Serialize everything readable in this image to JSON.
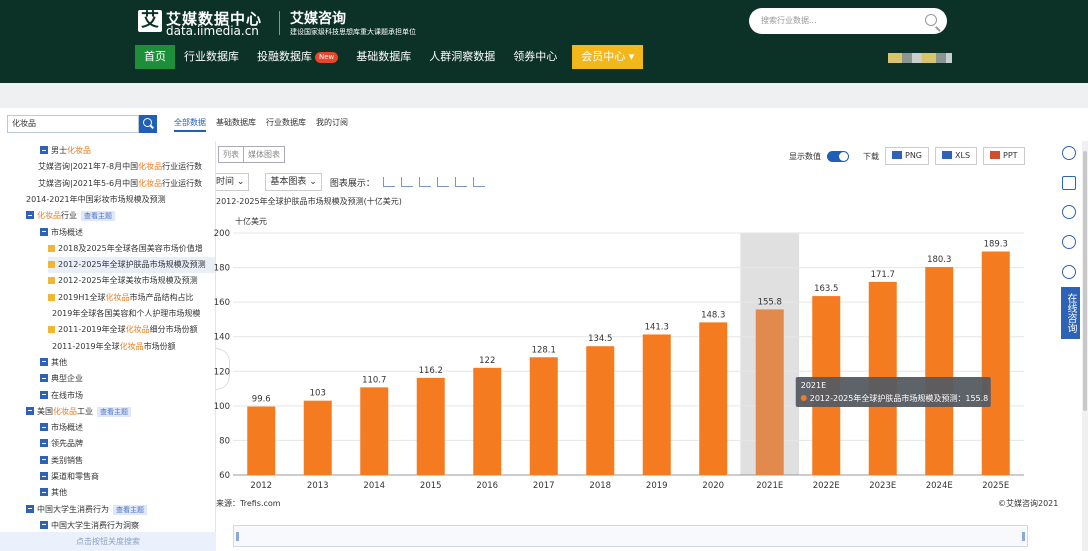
{
  "header": {
    "logo_glyph": "艾",
    "logo_cn": "艾媒数据中心",
    "logo_en": "data.iimedia.cn",
    "brand": "艾媒咨询",
    "brand_sub": "建设国家级科技思想库重大课题承担单位",
    "search_placeholder": "搜索行业数据..."
  },
  "nav": {
    "items": [
      "首页",
      "行业数据库",
      "投融数据库",
      "基础数据库",
      "人群洞察数据",
      "领券中心"
    ],
    "new_badge": "New",
    "member": "会员中心"
  },
  "search": {
    "value": "化妆品"
  },
  "tabs": [
    "全部数据",
    "基础数据库",
    "行业数据库",
    "我的订阅"
  ],
  "sidebar": {
    "rows": [
      {
        "text": "男士化妆品",
        "kind": "folder"
      },
      {
        "text": "艾媒咨询|2021年7-8月中国化妆品行业运行数",
        "kind": "plain"
      },
      {
        "text": "艾媒咨询|2021年5-6月中国化妆品行业运行数",
        "kind": "plain"
      },
      {
        "text": "2014-2021年中国彩妆市场规模及预测",
        "kind": "plain"
      },
      {
        "text": "化妆品行业",
        "kind": "folder",
        "tag": "查看主题"
      },
      {
        "text": "市场概述",
        "kind": "folder"
      },
      {
        "text": "2018及2025年全球各国美容市场价值增",
        "kind": "doc"
      },
      {
        "text": "2012-2025年全球护肤品市场规模及预测",
        "kind": "doc"
      },
      {
        "text": "2012-2025年全球美妆市场规模及预测",
        "kind": "doc"
      },
      {
        "text": "2019H1全球化妆品市场产品结构占比",
        "kind": "doc"
      },
      {
        "text": "2019年全球各国美容和个人护理市场规模",
        "kind": "plain"
      },
      {
        "text": "2011-2019年全球化妆品细分市场份额",
        "kind": "doc"
      },
      {
        "text": "2011-2019年全球化妆品市场份额",
        "kind": "plain"
      },
      {
        "text": "其他",
        "kind": "folder"
      },
      {
        "text": "典型企业",
        "kind": "folder"
      },
      {
        "text": "在线市场",
        "kind": "folder"
      },
      {
        "text": "美国化妆品工业",
        "kind": "folder",
        "tag": "查看主题"
      },
      {
        "text": "市场概述",
        "kind": "folder"
      },
      {
        "text": "领先品牌",
        "kind": "folder"
      },
      {
        "text": "类别销售",
        "kind": "folder"
      },
      {
        "text": "渠道和零售商",
        "kind": "folder"
      },
      {
        "text": "其他",
        "kind": "folder"
      },
      {
        "text": "中国大学生消费行为",
        "kind": "folder",
        "tag": "查看主题"
      },
      {
        "text": "中国大学生消费行为洞察",
        "kind": "folder"
      }
    ],
    "bottom": "点击按钮关度搜索"
  },
  "toolbar": {
    "view_list": "列表",
    "view_media": "媒体图表",
    "show_values": "显示数值",
    "download": "下载",
    "png": "PNG",
    "xls": "XLS",
    "ppt": "PPT",
    "time_select": "时间",
    "basic_chart": "基本图表",
    "chart_display": "图表展示："
  },
  "chart_title": "2012-2025年全球护肤品市场规模及预测(十亿美元)",
  "source": "来源：Trefis.com",
  "copyright": "©艾媒咨询2021",
  "consult": "在线咨询",
  "colors": {
    "bar": "#f47b20",
    "bar_hover": "#e2894d",
    "highlight": "#e0e0e0",
    "tooltip": "#555b62",
    "dot": "#f47b20",
    "nav_bg": "#0c3127"
  },
  "chart_data": {
    "type": "bar",
    "ylabel": "十亿美元",
    "ylim": [
      60,
      200
    ],
    "yticks": [
      60,
      80,
      100,
      120,
      140,
      160,
      180,
      200
    ],
    "categories": [
      "2012",
      "2013",
      "2014",
      "2015",
      "2016",
      "2017",
      "2018",
      "2019",
      "2020",
      "2021E",
      "2022E",
      "2023E",
      "2024E",
      "2025E"
    ],
    "series": [
      {
        "name": "2012-2025年全球护肤品市场规模及预测",
        "values": [
          99.6,
          103,
          110.7,
          116.2,
          122,
          128.1,
          134.5,
          141.3,
          148.3,
          155.8,
          163.5,
          171.7,
          180.3,
          189.3
        ]
      }
    ],
    "data_labels": [
      "99.6",
      "103",
      "110.7",
      "116.2",
      "122",
      "128.1",
      "134.5",
      "141.3",
      "148.3",
      "155.8",
      "163.5",
      "171.7",
      "180.3",
      "189.3"
    ],
    "highlighted_category": "2021E",
    "tooltip": {
      "title": "2021E",
      "label": "2012-2025年全球护肤品市场规模及预测：155.8"
    },
    "grid": true,
    "legend": "none"
  }
}
